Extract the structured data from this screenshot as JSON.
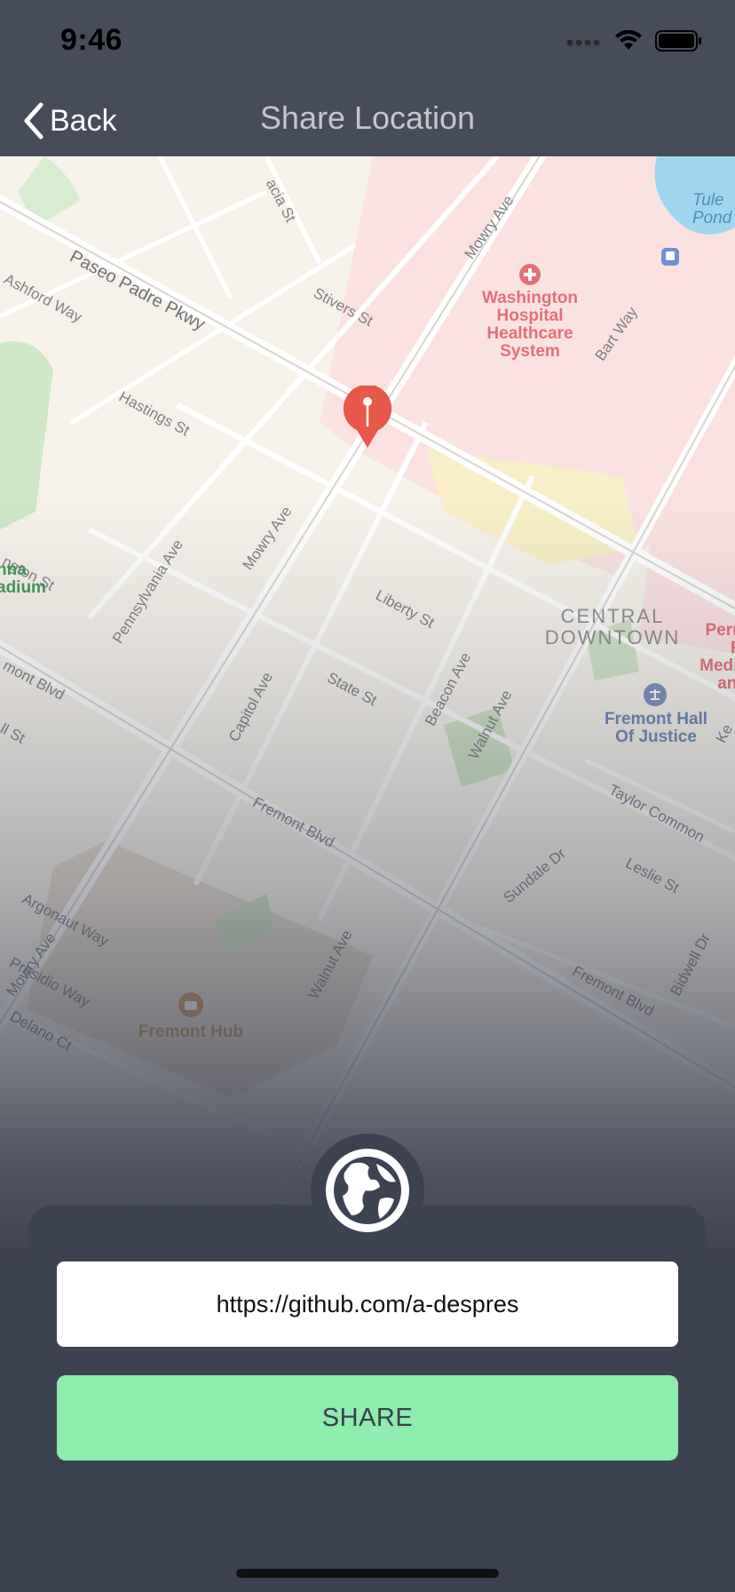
{
  "status_bar": {
    "time": "9:46"
  },
  "nav": {
    "back_label": "Back",
    "title": "Share Location"
  },
  "map": {
    "streets": [
      "Paseo Padre Pkwy",
      "Mowry Ave",
      "Mowry Ave",
      "Mowry Ave",
      "acia St",
      "Stivers St",
      "Ashford Way",
      "Hastings St",
      "Bart Way",
      "Pennsylvania Ave",
      "ngton St",
      "Liberty St",
      "State St",
      "Capitol Ave",
      "Beacon Ave",
      "Walnut Ave",
      "Walnut Ave",
      "mont Blvd",
      "Fremont Blvd",
      "Fremont Blvd",
      "Taylor Common",
      "Leslie St",
      "Sundale Dr",
      "Argonaut Way",
      "Presidio Way",
      "Delano Ct",
      "ll St",
      "Bidwell Dr",
      "Ke"
    ],
    "areas": {
      "hospital": "Washington\nHospital\nHealthcare\nSystem",
      "district": "CENTRAL\nDOWNTOWN",
      "justice": "Fremont Hall\nOf Justice",
      "hub": "Fremont Hub",
      "stadium": "nna\nadium",
      "pond": "Tule\nPond",
      "kaiser": "K\nPerm\nFr\nMedic\nand"
    }
  },
  "share": {
    "url_value": "https://github.com/a-despres",
    "button_label": "SHARE"
  },
  "colors": {
    "accent": "#8decae",
    "panel": "#3d4252",
    "pin": "#e8574a"
  }
}
